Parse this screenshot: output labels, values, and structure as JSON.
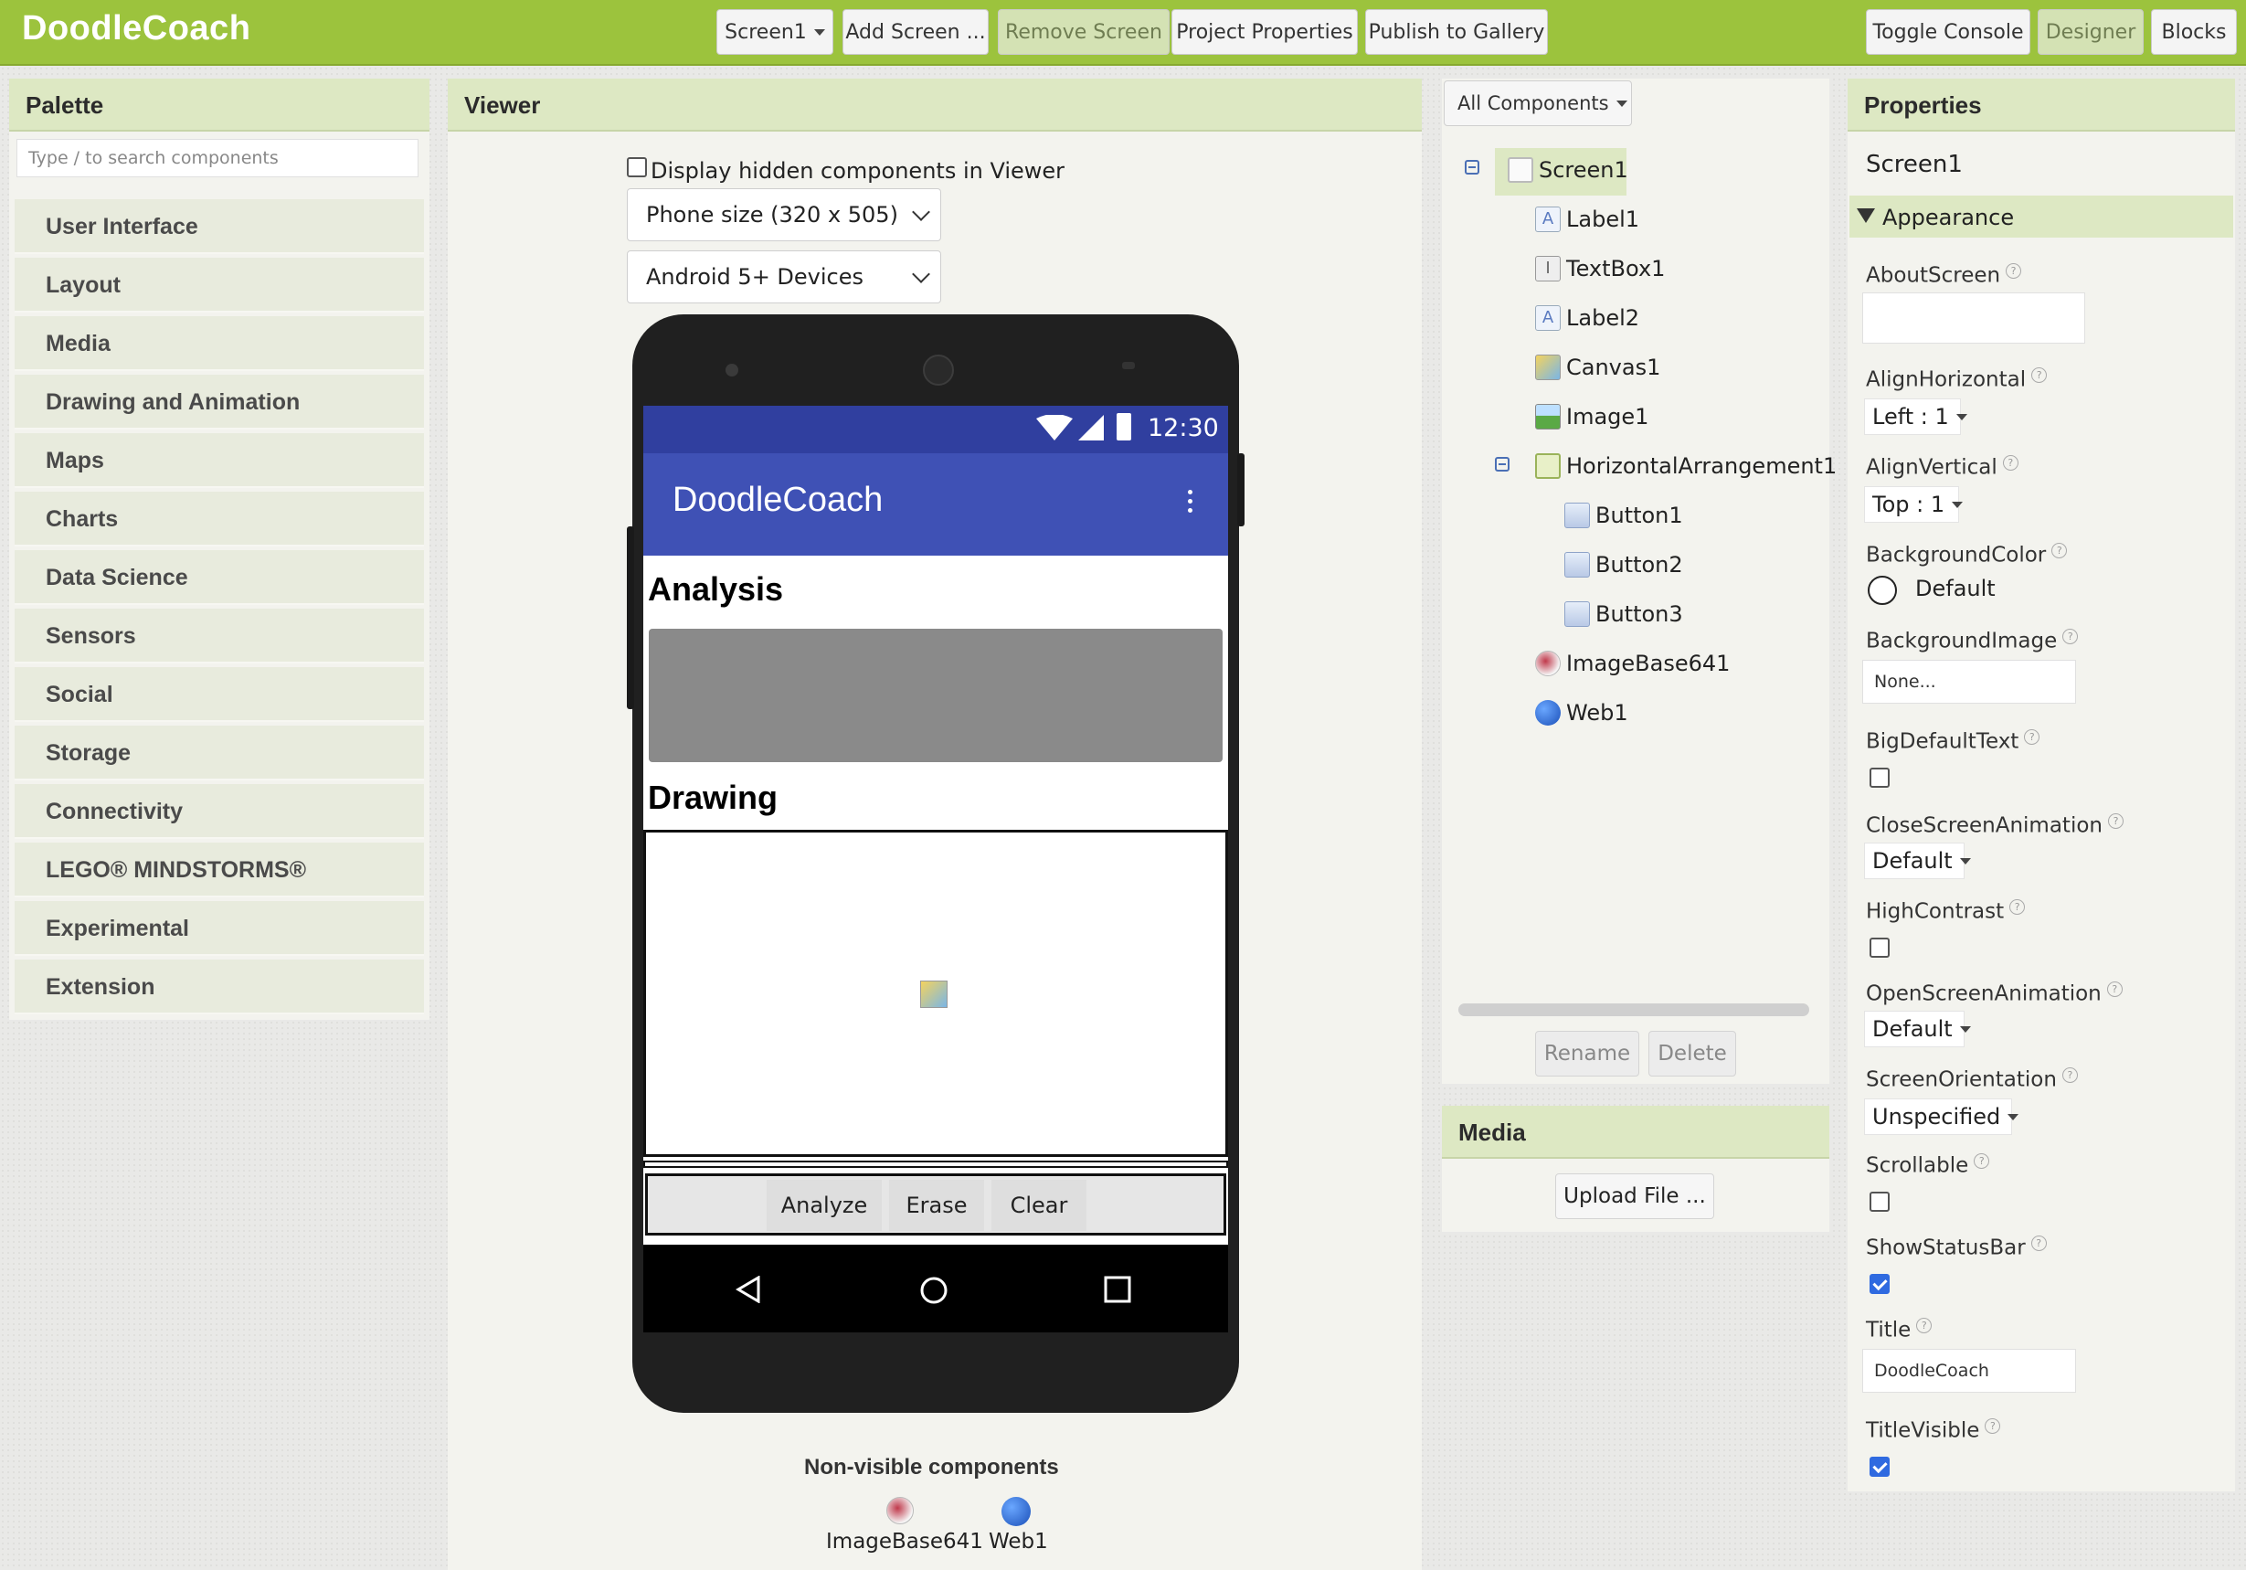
{
  "topbar": {
    "brand": "DoodleCoach",
    "screen_select": "Screen1",
    "add_screen": "Add Screen ...",
    "remove_screen": "Remove Screen",
    "project_properties": "Project Properties",
    "publish": "Publish to Gallery",
    "toggle_console": "Toggle Console",
    "designer": "Designer",
    "blocks": "Blocks"
  },
  "palette": {
    "title": "Palette",
    "search_placeholder": "Type / to search components",
    "items": [
      "User Interface",
      "Layout",
      "Media",
      "Drawing and Animation",
      "Maps",
      "Charts",
      "Data Science",
      "Sensors",
      "Social",
      "Storage",
      "Connectivity",
      "LEGO® MINDSTORMS®",
      "Experimental",
      "Extension"
    ]
  },
  "viewer": {
    "title": "Viewer",
    "hidden_label": "Display hidden components in Viewer",
    "size_select": "Phone size (320 x 505)",
    "device_select": "Android 5+ Devices",
    "phone": {
      "time": "12:30",
      "app_title": "DoodleCoach",
      "label1": "Analysis",
      "label2": "Drawing",
      "buttons": [
        "Analyze",
        "Erase",
        "Clear"
      ]
    },
    "nonvisible_title": "Non-visible components",
    "nonvisible": [
      "ImageBase641",
      "Web1"
    ]
  },
  "components": {
    "filter": "All Components",
    "tree": [
      "Screen1",
      "Label1",
      "TextBox1",
      "Label2",
      "Canvas1",
      "Image1",
      "HorizontalArrangement1",
      "Button1",
      "Button2",
      "Button3",
      "ImageBase641",
      "Web1"
    ],
    "rename": "Rename",
    "delete": "Delete"
  },
  "media": {
    "title": "Media",
    "upload": "Upload File ..."
  },
  "properties": {
    "title": "Properties",
    "component": "Screen1",
    "section": "Appearance",
    "about_screen": "AboutScreen",
    "align_horizontal": "AlignHorizontal",
    "align_horizontal_value": "Left : 1",
    "align_vertical": "AlignVertical",
    "align_vertical_value": "Top : 1",
    "background_color": "BackgroundColor",
    "background_color_value": "Default",
    "background_image": "BackgroundImage",
    "background_image_value": "None...",
    "big_default_text": "BigDefaultText",
    "close_anim": "CloseScreenAnimation",
    "close_anim_value": "Default",
    "high_contrast": "HighContrast",
    "open_anim": "OpenScreenAnimation",
    "open_anim_value": "Default",
    "orientation": "ScreenOrientation",
    "orientation_value": "Unspecified",
    "scrollable": "Scrollable",
    "show_status_bar": "ShowStatusBar",
    "title_prop": "Title",
    "title_value": "DoodleCoach",
    "title_visible": "TitleVisible",
    "help_glyph": "?"
  },
  "colors": {
    "topbar": "#9cc33d",
    "panel_header": "#dde8c3",
    "app_bar": "#3f51b5",
    "status_bar": "#303f9f",
    "checkbox_on": "#2f6ae0"
  }
}
